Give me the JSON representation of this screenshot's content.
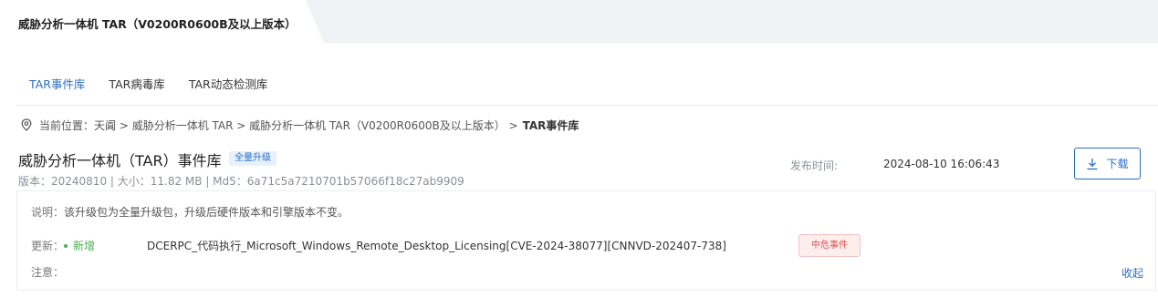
{
  "window": {
    "active_tab_label": "威胁分析一体机 TAR（V0200R0600B及以上版本）"
  },
  "subtabs": [
    {
      "label": "TAR事件库",
      "active": true
    },
    {
      "label": "TAR病毒库",
      "active": false
    },
    {
      "label": "TAR动态检测库",
      "active": false
    }
  ],
  "breadcrumb": {
    "prefix": "当前位置：",
    "path": "天阗 > 威胁分析一体机 TAR > 威胁分析一体机 TAR（V0200R0600B及以上版本） >",
    "current": "TAR事件库"
  },
  "package": {
    "title": "威胁分析一体机（TAR）事件库",
    "badge": "全量升级",
    "meta": "版本：20240810 | 大小：11.82 MB | Md5：6a71c5a7210701b57066f18c27ab9909",
    "publish_label": "发布时间:",
    "publish_time": "2024-08-10 16:06:43",
    "download_label": "下载"
  },
  "details": {
    "description_label": "说明：",
    "description": "该升级包为全量升级包，升级后硬件版本和引擎版本不变。",
    "update_label": "更新：",
    "update_type": "新增",
    "update_name": "DCERPC_代码执行_Microsoft_Windows_Remote_Desktop_Licensing[CVE-2024-38077][CNNVD-202407-738]",
    "severity": "中危事件",
    "note_label": "注意：",
    "collapse_label": "收起"
  },
  "colors": {
    "accent": "#2a6ec5",
    "new_green": "#4fae4f",
    "severity_red": "#d9534f",
    "topbar_bg": "#f1f2f5"
  },
  "icons": {
    "breadcrumb": "location-pin-icon",
    "download": "download-icon"
  }
}
